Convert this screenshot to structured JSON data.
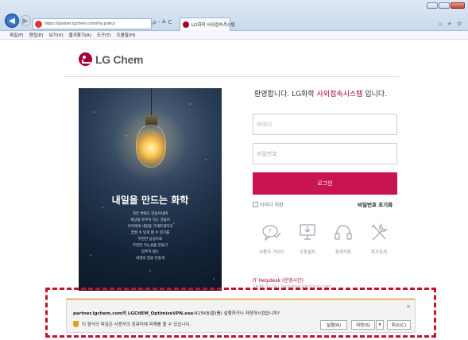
{
  "browser": {
    "url": "https://partner.lgchem.com/my.policy",
    "address_tools": "ρ - ≙ C",
    "tab_title": "LG화학 사외접속시스템",
    "tab_close": "×",
    "menu": [
      "파일(F)",
      "편집(E)",
      "보기(V)",
      "즐겨찾기(A)",
      "도구(T)",
      "도움말(H)"
    ],
    "right_tools": "⌂ ★ ✿"
  },
  "page": {
    "logo_text": "LG Chem",
    "poster": {
      "headline": "내일을 만드는 화학",
      "lines": [
        "작은 변화도 만들어내며",
        "세상을 바꾸어 가는 것들이",
        "우리에게 내일을 기대하게하고",
        "꿈꿀 수 있게 할 수 있기를",
        "무한한 상상으로",
        "무한한 가능성을 만들기",
        "멈추지 않는",
        "내일의 힘을 만들게"
      ]
    },
    "welcome_prefix": "환영합니다. LG화학 ",
    "welcome_highlight": "사외접속시스템",
    "welcome_suffix": " 입니다.",
    "id_placeholder": "아이디",
    "pw_placeholder": "비밀번호",
    "login_label": "로그인",
    "remember_label": "아이디 저장",
    "reset_pw_label": "비밀번호 초기화",
    "tools": [
      {
        "label": "사용자 가이드",
        "icon": "question-bubble-icon"
      },
      {
        "label": "수동설치",
        "icon": "monitor-download-icon"
      },
      {
        "label": "원격지원",
        "icon": "headset-icon"
      },
      {
        "label": "자가조치",
        "icon": "wrench-icon"
      }
    ],
    "helpdesk_label": "IT Helpdesk (운영시간)",
    "helpdesk_sub": "1644-3119 | helpdesk@lgchem.com"
  },
  "download_bar": {
    "message_file": "partner.lgchem.com의 LGCHEM_OptimizeVPN.exe",
    "message_rest": "(425KB)을(를) 실행하거나 저장하시겠습니까?",
    "warning": "이 형식의 파일은 사용자의 컴퓨터에 피해를 줄 수 있습니다.",
    "run_label": "실행(R)",
    "save_label": "저장(S)",
    "save_dropdown": "▾",
    "cancel_label": "취소(C)",
    "close": "×"
  },
  "colors": {
    "brand": "#a50034",
    "login_button": "#c8144f",
    "highlight_box": "#c6102e"
  }
}
